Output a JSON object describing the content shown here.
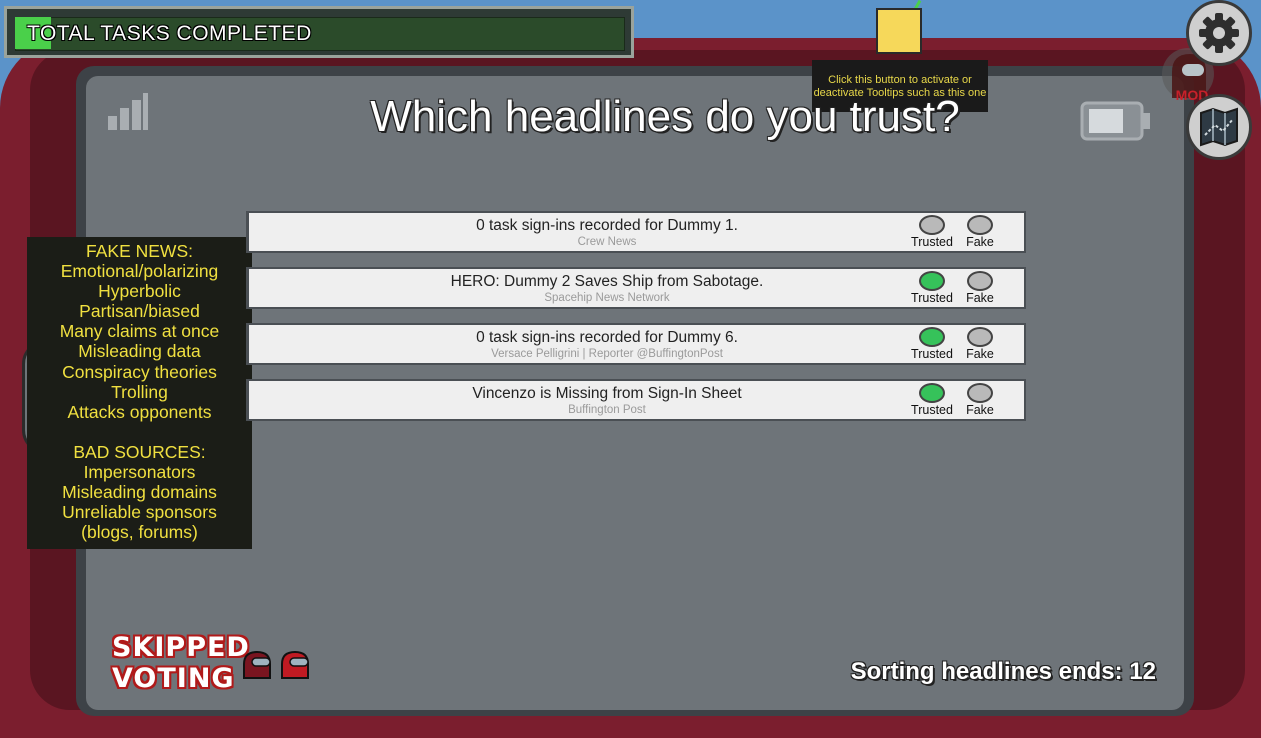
{
  "task_bar": {
    "label": "TOTAL TASKS COMPLETED",
    "progress_fraction": 0.06
  },
  "tooltip": {
    "line1": "Click this button to activate or",
    "line2": "deactivate Tooltips such as this one"
  },
  "mod_badge": "MOD",
  "title": "Which headlines do you trust?",
  "cheat_sheet": {
    "fake_news_heading": "FAKE NEWS:",
    "fake_news_items": [
      "Emotional/polarizing",
      "Hyperbolic",
      "Partisan/biased",
      "Many claims at once",
      "Misleading data",
      "Conspiracy theories",
      "Trolling",
      "Attacks opponents"
    ],
    "bad_sources_heading": "BAD SOURCES:",
    "bad_sources_items": [
      "Impersonators",
      "Misleading domains",
      "Unreliable sponsors",
      "(blogs, forums)"
    ]
  },
  "options": {
    "trusted_label": "Trusted",
    "fake_label": "Fake"
  },
  "headlines": [
    {
      "headline": "0 task sign-ins recorded for Dummy 1.",
      "source": "Crew News",
      "trusted_selected": false,
      "fake_selected": false
    },
    {
      "headline": "HERO: Dummy 2 Saves Ship from Sabotage.",
      "source": "Spacehip News Network",
      "trusted_selected": true,
      "fake_selected": false
    },
    {
      "headline": "0 task sign-ins recorded for Dummy 6.",
      "source": "Versace Pelligrini | Reporter @BuffingtonPost",
      "trusted_selected": true,
      "fake_selected": false
    },
    {
      "headline": "Vincenzo is Missing from Sign-In Sheet",
      "source": "Buffington Post",
      "trusted_selected": true,
      "fake_selected": false
    }
  ],
  "skipped": {
    "line1": "SKIPPED",
    "line2": "VOTING"
  },
  "timer": {
    "label": "Sorting headlines ends: ",
    "seconds": "12"
  },
  "colors": {
    "tablet": "#7b1e2e",
    "screen": "#6e7479",
    "cheat_text": "#f0e040",
    "trusted_on": "#36c25a",
    "task_fill": "#4ad04a"
  }
}
